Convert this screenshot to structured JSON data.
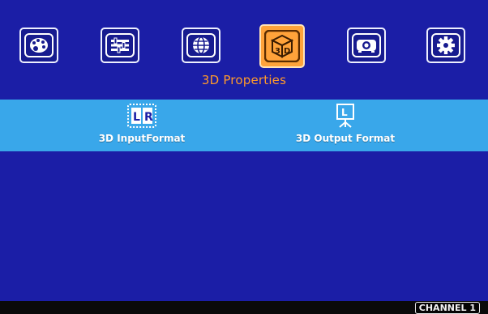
{
  "nav": {
    "items": [
      {
        "icon": "palette-icon",
        "label": ""
      },
      {
        "icon": "equalizer-icon",
        "label": ""
      },
      {
        "icon": "globe-icon",
        "label": ""
      },
      {
        "icon": "3d-cube-icon",
        "label": "3D",
        "active": true
      },
      {
        "icon": "projector-icon",
        "label": ""
      },
      {
        "icon": "gear-icon",
        "label": ""
      }
    ]
  },
  "section": {
    "title": "3D Properties"
  },
  "submenu": {
    "items": [
      {
        "label": "3D InputFormat",
        "icon": "lr-format-icon",
        "icon_text_left": "L",
        "icon_text_right": "R"
      },
      {
        "label": "3D Output Format",
        "icon": "projection-screen-icon",
        "icon_text": "L"
      }
    ]
  },
  "footer": {
    "channel": "CHANNEL 1"
  },
  "colors": {
    "background": "#1b1ea6",
    "highlight_bar": "#39a7ea",
    "accent": "#ff9a2a",
    "active_tab": "#ffa33a"
  }
}
